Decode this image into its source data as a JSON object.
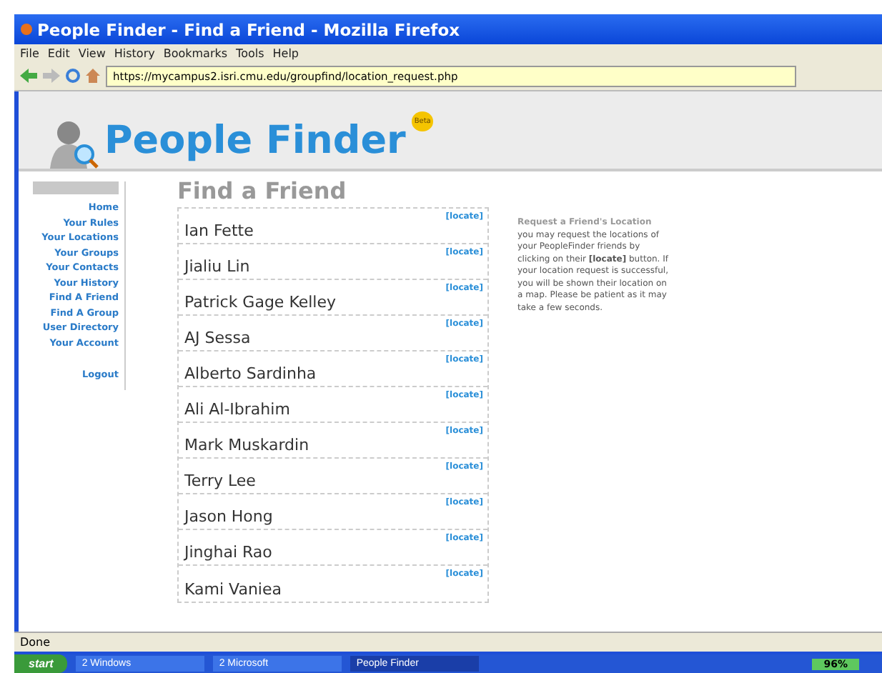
{
  "window": {
    "title": "People Finder - Find a Friend - Mozilla Firefox"
  },
  "menu": [
    "File",
    "Edit",
    "View",
    "History",
    "Bookmarks",
    "Tools",
    "Help"
  ],
  "address": "https://mycampus2.isri.cmu.edu/groupfind/location_request.php",
  "logo": {
    "text": "People Finder",
    "badge": "Beta"
  },
  "sidebar": {
    "items": [
      {
        "label": "Home"
      },
      {
        "label": "Your Rules"
      },
      {
        "label": "Your Locations"
      },
      {
        "label": "Your Groups"
      },
      {
        "label": "Your Contacts"
      },
      {
        "label": "Your History"
      },
      {
        "label": "Find A Friend"
      },
      {
        "label": "Find A Group"
      },
      {
        "label": "User Directory"
      },
      {
        "label": "Your Account"
      },
      {
        "label": "Logout"
      }
    ]
  },
  "heading": "Find a Friend",
  "friends": [
    {
      "name": "Ian Fette",
      "action": "[locate]"
    },
    {
      "name": "Jialiu Lin",
      "action": "[locate]"
    },
    {
      "name": "Patrick Gage Kelley",
      "action": "[locate]"
    },
    {
      "name": "AJ Sessa",
      "action": "[locate]"
    },
    {
      "name": "Alberto Sardinha",
      "action": "[locate]"
    },
    {
      "name": "Ali Al-Ibrahim",
      "action": "[locate]"
    },
    {
      "name": "Mark Muskardin",
      "action": "[locate]"
    },
    {
      "name": "Terry Lee",
      "action": "[locate]"
    },
    {
      "name": "Jason Hong",
      "action": "[locate]"
    },
    {
      "name": "Jinghai Rao",
      "action": "[locate]"
    },
    {
      "name": "Kami Vaniea",
      "action": "[locate]"
    }
  ],
  "help": {
    "title": "Request a Friend's Location",
    "body": "you may request the locations of your PeopleFinder friends by clicking on their **[locate]** button. If your location request is successful, you will be shown their location on a map. Please be patient as it may take a few seconds."
  },
  "status_bar": "Done",
  "taskbar": {
    "start": "start",
    "tasks": [
      {
        "label": "2 Windows",
        "selected": false
      },
      {
        "label": "2 Microsoft",
        "selected": false
      },
      {
        "label": "People Finder",
        "selected": true
      }
    ],
    "battery": "96%"
  }
}
